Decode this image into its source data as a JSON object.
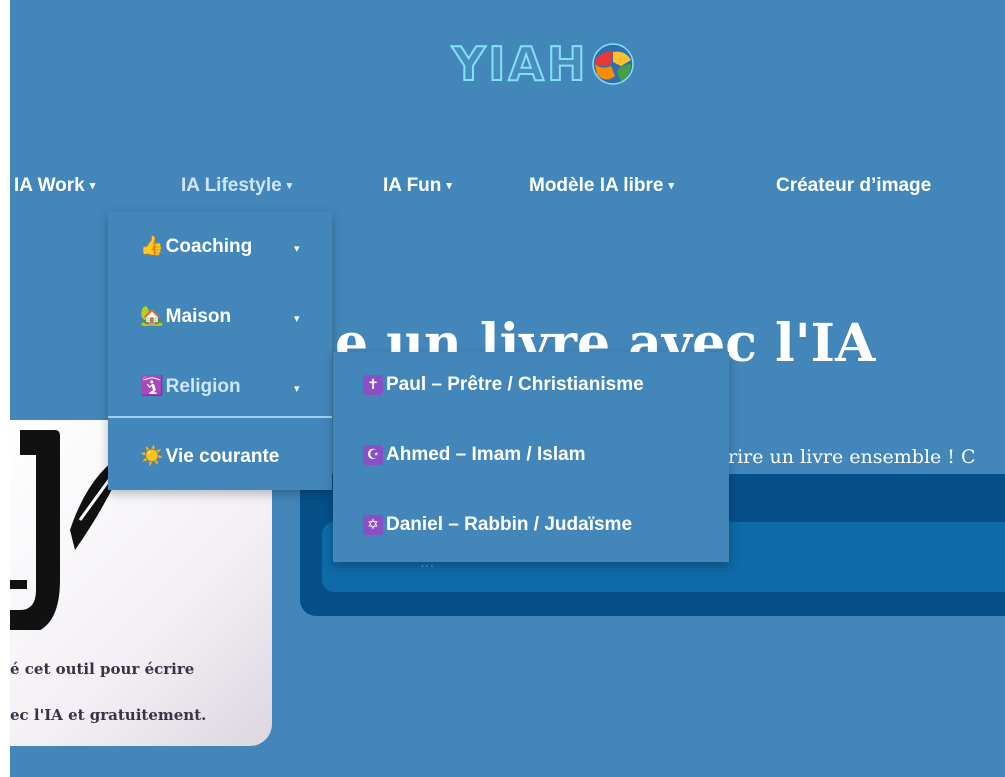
{
  "logo": {
    "text": "YIAH"
  },
  "nav": [
    {
      "label": "IA Work",
      "caret": "▾"
    },
    {
      "label": "IA Lifestyle",
      "caret": "▾"
    },
    {
      "label": "IA Fun",
      "caret": "▾"
    },
    {
      "label": "Modèle IA libre",
      "caret": "▾"
    },
    {
      "label": "Créateur d’image"
    }
  ],
  "dropdown": {
    "items": [
      {
        "emoji": "👍",
        "label": "Coaching",
        "caret": "▾"
      },
      {
        "emoji": "🏡",
        "label": "Maison",
        "caret": "▾"
      },
      {
        "emoji": "🛐",
        "label": "Religion",
        "caret": "▾"
      },
      {
        "emoji": "☀️",
        "label": "Vie courante"
      }
    ]
  },
  "submenu": {
    "items": [
      {
        "symbol": "✝",
        "label": "Paul – Prêtre / Christianisme"
      },
      {
        "symbol": "☪",
        "label": "Ahmed – Imam / Islam"
      },
      {
        "symbol": "✡",
        "label": "Daniel – Rabbin / Judaïsme"
      }
    ]
  },
  "hero": {
    "heading": "e un livre avec l'IA",
    "subtitle": "rire un livre ensemble ! C",
    "input_placeholder": "..."
  },
  "card": {
    "line1": "é cet outil pour écrire",
    "line2": "ec l'IA et gratuitement."
  }
}
